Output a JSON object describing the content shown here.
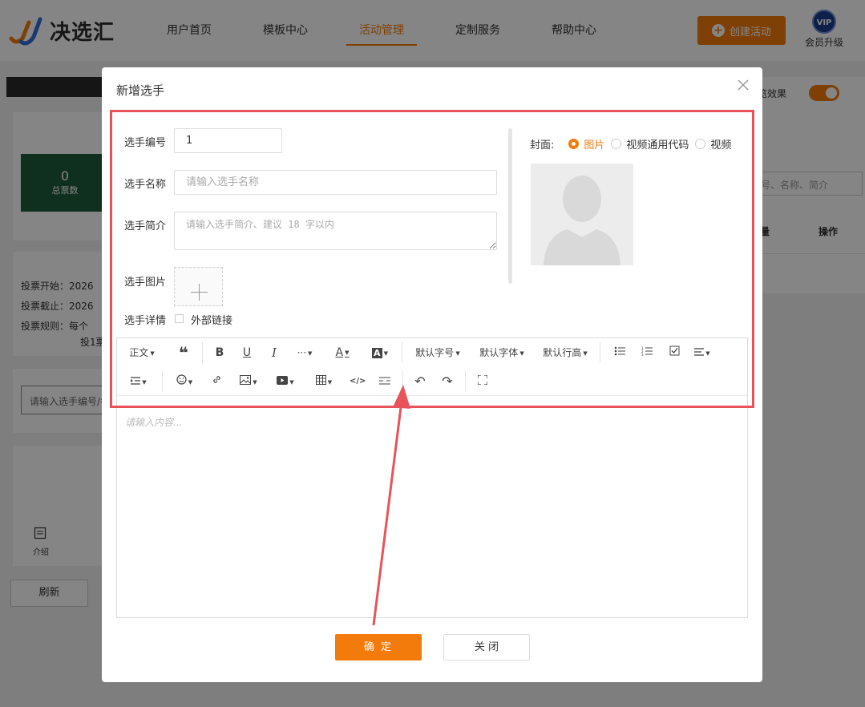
{
  "brand": {
    "name": "决选汇"
  },
  "nav": {
    "items": [
      {
        "label": "用户首页",
        "active": false
      },
      {
        "label": "模板中心",
        "active": false
      },
      {
        "label": "活动管理",
        "active": true
      },
      {
        "label": "定制服务",
        "active": false
      },
      {
        "label": "帮助中心",
        "active": false
      }
    ],
    "create_label": "创建活动",
    "vip_badge": "VIP",
    "vip_label": "会员升级"
  },
  "background": {
    "preview_effect": "览效果",
    "stat_value": "0",
    "stat_label": "总票数",
    "vote_start": "投票开始：2026",
    "vote_end": "投票截止：2026",
    "vote_rule": "投票规则：每个",
    "vote_rule_2": "投1票",
    "search_placeholder": "请输入选手编号/名",
    "search_right": "号、名称、简介",
    "col_right": "量",
    "col_action": "操作",
    "intro_label": "介绍",
    "refresh_label": "刷新"
  },
  "modal": {
    "title": "新增选手",
    "fields": {
      "number_label": "选手编号",
      "number_value": "1",
      "name_label": "选手名称",
      "name_placeholder": "请输入选手名称",
      "intro_label": "选手简介",
      "intro_placeholder": "请输入选手简介、建议 18 字以内",
      "image_label": "选手图片",
      "detail_label": "选手详情",
      "external_link_label": "外部链接"
    },
    "cover": {
      "label": "封面:",
      "options": [
        {
          "label": "图片",
          "checked": true
        },
        {
          "label": "视频通用代码",
          "checked": false
        },
        {
          "label": "视频",
          "checked": false
        }
      ]
    },
    "toolbar": {
      "paragraph": "正文",
      "font_size": "默认字号",
      "font_family": "默认字体",
      "line_height": "默认行高",
      "more": "···"
    },
    "editor_placeholder": "请输入内容...",
    "confirm_label": "确 定",
    "close_label": "关 闭"
  },
  "colors": {
    "accent": "#f37b0b",
    "annotation": "#e8525a"
  }
}
